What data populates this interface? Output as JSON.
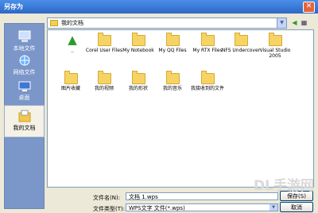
{
  "window": {
    "title": "另存为",
    "close_glyph": "✕"
  },
  "lookin": {
    "value": "我的文档",
    "arrow": "▼"
  },
  "toolbar": {
    "back_glyph": "◀",
    "views_glyph": "▦"
  },
  "places": [
    {
      "label": "本地文件",
      "icon": "computer-icon"
    },
    {
      "label": "网络文件",
      "icon": "network-icon"
    },
    {
      "label": "桌面",
      "icon": "desktop-icon"
    },
    {
      "label": "我的文档",
      "icon": "documents-icon",
      "active": true
    }
  ],
  "files_row1": [
    {
      "name": "..",
      "type": "up"
    },
    {
      "name": "Corel User Files",
      "type": "folder"
    },
    {
      "name": "My Notebook",
      "type": "folder"
    },
    {
      "name": "My QQ Files",
      "type": "folder"
    },
    {
      "name": "My RTX Files",
      "type": "folder"
    },
    {
      "name": "NFS Undercover",
      "type": "folder"
    },
    {
      "name": "Visual Studio 2005",
      "type": "folder"
    }
  ],
  "files_row2": [
    {
      "name": "图片收藏",
      "type": "folder"
    },
    {
      "name": "我的视频",
      "type": "folder"
    },
    {
      "name": "我的形状",
      "type": "folder"
    },
    {
      "name": "我的音乐",
      "type": "folder"
    },
    {
      "name": "我接收到的文件",
      "type": "folder"
    }
  ],
  "filename": {
    "label": "文件名(N):",
    "value": "文档 1.wps"
  },
  "filetype": {
    "label": "文件类型(T):",
    "value": "WPS文字 文件(*.wps)"
  },
  "buttons": {
    "save": "保存(S)",
    "cancel": "取消"
  },
  "watermark": "DL手游网",
  "colors": {
    "title_bar": "#2d68c8",
    "places_bar": "#7b96c8",
    "folder": "#f6d365",
    "dialog_bg": "#ece9d8"
  }
}
